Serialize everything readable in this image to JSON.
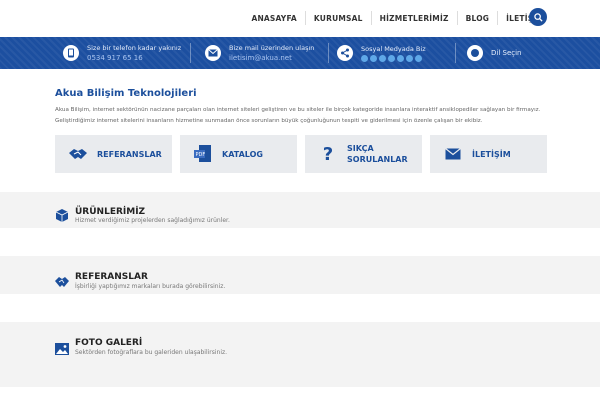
{
  "nav": {
    "items": [
      "ANASAYFA",
      "KURUMSAL",
      "HİZMETLERİMİZ",
      "BLOG",
      "İLETİŞİM"
    ],
    "search_icon": "search-icon"
  },
  "infobar": {
    "phone_caption": "Size bir telefon kadar yakınız",
    "phone": "0534 917 65 16",
    "mail_caption": "Bize mail üzerinden ulaşın",
    "mail": "iletisim@akua.net",
    "social_caption": "Sosyal Medyada Biz",
    "language": "Dil Seçin"
  },
  "intro": {
    "title": "Akua Bilişim Teknolojileri",
    "text": "Akua Bilişim, internet sektörünün nacizane parçaları olan internet siteleri geliştiren ve bu siteler ile birçok kategoride insanlara interaktif ansiklopediler sağlayan bir firmayız. Geliştirdiğimiz internet sitelerini insanların hizmetine sunmadan önce sorunların büyük çoğunluğunun tespiti ve giderilmesi için özenle çalışan bir ekibiz."
  },
  "tiles": {
    "referanslar": "REFERANSLAR",
    "katalog": "KATALOG",
    "sss_line1": "SIKÇA",
    "sss_line2": "SORULANLAR",
    "iletisim": "İLETİŞİM"
  },
  "sections": {
    "urunler": {
      "title": "ÜRÜNLERİMİZ",
      "subtitle": "Hizmet verdiğimiz projelerden sağladığımız ürünler."
    },
    "referanslar": {
      "title": "REFERANSLAR",
      "subtitle": "İşbirliği yaptığımız markaları burada görebilirsiniz."
    },
    "galeri": {
      "title": "FOTO GALERİ",
      "subtitle": "Sektörden fotoğraflara bu galeriden ulaşabilirsiniz."
    }
  },
  "colors": {
    "brand_blue": "#1c4f9c",
    "bar_blue": "#1c4fa0",
    "tile_bg": "#e9ebee",
    "section_bg": "#f3f3f3"
  }
}
